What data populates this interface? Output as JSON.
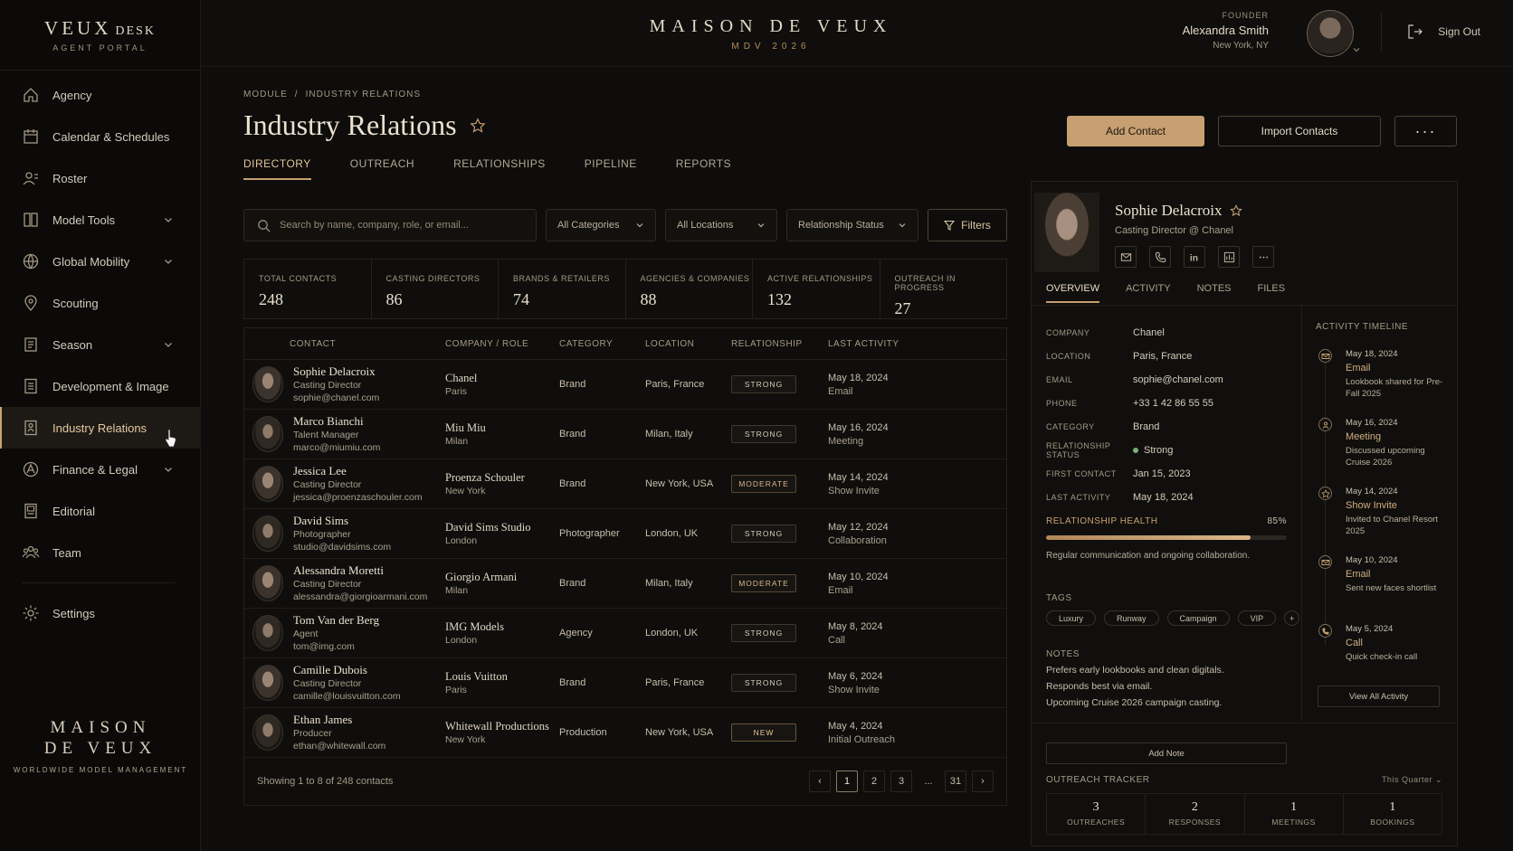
{
  "brand": {
    "logo": "VEUX",
    "logo_small": "DESK",
    "sub": "AGENT PORTAL"
  },
  "sidebar": {
    "items": [
      {
        "label": "Agency",
        "icon": "home-icon"
      },
      {
        "label": "Calendar & Schedules",
        "icon": "calendar-icon"
      },
      {
        "label": "Roster",
        "icon": "roster-icon"
      },
      {
        "label": "Model Tools",
        "icon": "tools-icon",
        "expandable": true
      },
      {
        "label": "Global Mobility",
        "icon": "globe-icon",
        "expandable": true
      },
      {
        "label": "Scouting",
        "icon": "pin-icon"
      },
      {
        "label": "Season",
        "icon": "season-icon",
        "expandable": true
      },
      {
        "label": "Development & Image",
        "icon": "image-icon"
      },
      {
        "label": "Industry Relations",
        "icon": "relations-icon",
        "active": true
      },
      {
        "label": "Finance & Legal",
        "icon": "finance-icon",
        "expandable": true
      },
      {
        "label": "Editorial",
        "icon": "editorial-icon"
      },
      {
        "label": "Team",
        "icon": "team-icon"
      },
      {
        "label": "Settings",
        "icon": "gear-icon"
      }
    ],
    "footer": {
      "line1": "MAISON",
      "line2": "DE VEUX",
      "tagline": "WORLDWIDE MODEL MANAGEMENT"
    }
  },
  "topbar": {
    "title": "MAISON DE VEUX",
    "subtitle": "MDV 2026",
    "user_role": "FOUNDER",
    "user_name": "Alexandra Smith",
    "user_location": "New York, NY",
    "signout": "Sign Out"
  },
  "page": {
    "breadcrumb": [
      "MODULE",
      "INDUSTRY RELATIONS"
    ],
    "title": "Industry Relations",
    "actions": {
      "add": "Add Contact",
      "import": "Import Contacts",
      "more": "···"
    },
    "tabs": [
      "DIRECTORY",
      "OUTREACH",
      "RELATIONSHIPS",
      "PIPELINE",
      "REPORTS"
    ],
    "active_tab": 0,
    "search_placeholder": "Search by name, company, role, or email...",
    "selects": [
      "All Categories",
      "All Locations",
      "Relationship Status"
    ],
    "filters_label": "Filters"
  },
  "stats": [
    {
      "label": "TOTAL CONTACTS",
      "value": "248"
    },
    {
      "label": "CASTING DIRECTORS",
      "value": "86"
    },
    {
      "label": "BRANDS & RETAILERS",
      "value": "74"
    },
    {
      "label": "AGENCIES & COMPANIES",
      "value": "88"
    },
    {
      "label": "ACTIVE RELATIONSHIPS",
      "value": "132"
    },
    {
      "label": "OUTREACH IN PROGRESS",
      "value": "27"
    }
  ],
  "table": {
    "headers": [
      "CONTACT",
      "COMPANY / ROLE",
      "CATEGORY",
      "LOCATION",
      "RELATIONSHIP",
      "LAST ACTIVITY"
    ],
    "rows": [
      {
        "name": "Sophie Delacroix",
        "role": "Casting Director",
        "email": "sophie@chanel.com",
        "company": "Chanel",
        "city": "Paris",
        "category": "Brand",
        "location": "Paris, France",
        "relationship": "STRONG",
        "date": "May 18, 2024",
        "activity": "Email",
        "gender": "f"
      },
      {
        "name": "Marco Bianchi",
        "role": "Talent Manager",
        "email": "marco@miumiu.com",
        "company": "Miu Miu",
        "city": "Milan",
        "category": "Brand",
        "location": "Milan, Italy",
        "relationship": "STRONG",
        "date": "May 16, 2024",
        "activity": "Meeting",
        "gender": "m"
      },
      {
        "name": "Jessica Lee",
        "role": "Casting Director",
        "email": "jessica@proenzaschouler.com",
        "company": "Proenza Schouler",
        "city": "New York",
        "category": "Brand",
        "location": "New York, USA",
        "relationship": "MODERATE",
        "date": "May 14, 2024",
        "activity": "Show Invite",
        "gender": "f"
      },
      {
        "name": "David Sims",
        "role": "Photographer",
        "email": "studio@davidsims.com",
        "company": "David Sims Studio",
        "city": "London",
        "category": "Photographer",
        "location": "London, UK",
        "relationship": "STRONG",
        "date": "May 12, 2024",
        "activity": "Collaboration",
        "gender": "m"
      },
      {
        "name": "Alessandra Moretti",
        "role": "Casting Director",
        "email": "alessandra@giorgioarmani.com",
        "company": "Giorgio Armani",
        "city": "Milan",
        "category": "Brand",
        "location": "Milan, Italy",
        "relationship": "MODERATE",
        "date": "May 10, 2024",
        "activity": "Email",
        "gender": "f"
      },
      {
        "name": "Tom Van der Berg",
        "role": "Agent",
        "email": "tom@img.com",
        "company": "IMG Models",
        "city": "London",
        "category": "Agency",
        "location": "London, UK",
        "relationship": "STRONG",
        "date": "May 8, 2024",
        "activity": "Call",
        "gender": "m"
      },
      {
        "name": "Camille Dubois",
        "role": "Casting Director",
        "email": "camille@louisvuitton.com",
        "company": "Louis Vuitton",
        "city": "Paris",
        "category": "Brand",
        "location": "Paris, France",
        "relationship": "STRONG",
        "date": "May 6, 2024",
        "activity": "Show Invite",
        "gender": "f"
      },
      {
        "name": "Ethan James",
        "role": "Producer",
        "email": "ethan@whitewall.com",
        "company": "Whitewall Productions",
        "city": "New York",
        "category": "Production",
        "location": "New York, USA",
        "relationship": "NEW",
        "date": "May 4, 2024",
        "activity": "Initial Outreach",
        "gender": "m"
      }
    ],
    "footer": "Showing 1 to 8 of 248 contacts",
    "pages": [
      "‹",
      "1",
      "2",
      "3",
      "...",
      "31",
      "›"
    ],
    "current_page": "1"
  },
  "profile": {
    "name": "Sophie Delacroix",
    "role": "Casting Director @ Chanel",
    "tabs": [
      "OVERVIEW",
      "ACTIVITY",
      "NOTES",
      "FILES"
    ],
    "fields": [
      {
        "k": "COMPANY",
        "v": "Chanel"
      },
      {
        "k": "LOCATION",
        "v": "Paris, France"
      },
      {
        "k": "EMAIL",
        "v": "sophie@chanel.com"
      },
      {
        "k": "PHONE",
        "v": "+33 1 42 86 55 55"
      },
      {
        "k": "CATEGORY",
        "v": "Brand"
      },
      {
        "k": "RELATIONSHIP STATUS",
        "v": "Strong"
      },
      {
        "k": "FIRST CONTACT",
        "v": "Jan 15, 2023"
      },
      {
        "k": "LAST ACTIVITY",
        "v": "May 18, 2024"
      }
    ],
    "health": {
      "label": "RELATIONSHIP HEALTH",
      "pct_text": "85%",
      "value": 0.85,
      "note": "Regular communication and ongoing collaboration."
    },
    "tags_label": "TAGS",
    "tags": [
      "Luxury",
      "Runway",
      "Campaign",
      "VIP"
    ],
    "tag_add": "+",
    "notes_label": "NOTES",
    "notes": [
      "Prefers early lookbooks and clean digitals.",
      "Responds best via email.",
      "Upcoming Cruise 2026 campaign casting."
    ],
    "add_note": "Add Note",
    "timeline_label": "ACTIVITY TIMELINE",
    "timeline": [
      {
        "date": "May 18, 2024",
        "type": "Email",
        "desc": "Lookbook shared for Pre-Fall 2025"
      },
      {
        "date": "May 16, 2024",
        "type": "Meeting",
        "desc": "Discussed upcoming Cruise 2026"
      },
      {
        "date": "May 14, 2024",
        "type": "Show Invite",
        "desc": "Invited to Chanel Resort 2025"
      },
      {
        "date": "May 10, 2024",
        "type": "Email",
        "desc": "Sent new faces shortlist"
      },
      {
        "date": "May 5, 2024",
        "type": "Call",
        "desc": "Quick check-in call"
      }
    ],
    "view_all": "View All Activity",
    "tracker_label": "OUTREACH TRACKER",
    "tracker_period": "This Quarter ⌄",
    "tracker": [
      {
        "n": "3",
        "l": "OUTREACHES"
      },
      {
        "n": "2",
        "l": "RESPONSES"
      },
      {
        "n": "1",
        "l": "MEETINGS"
      },
      {
        "n": "1",
        "l": "BOOKINGS"
      }
    ]
  }
}
